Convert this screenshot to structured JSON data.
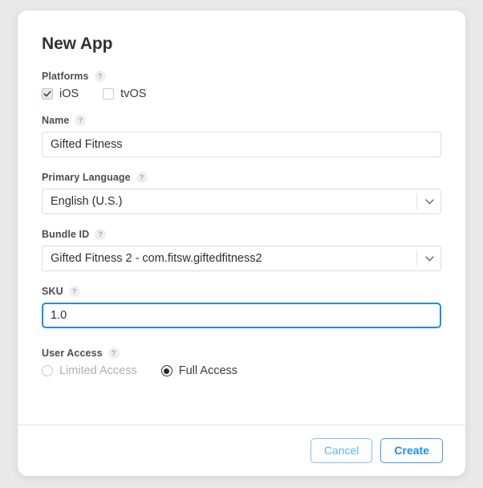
{
  "dialog": {
    "title": "New App",
    "help_glyph": "?"
  },
  "platforms": {
    "label": "Platforms",
    "options": [
      {
        "label": "iOS",
        "checked": true
      },
      {
        "label": "tvOS",
        "checked": false
      }
    ]
  },
  "name": {
    "label": "Name",
    "value": "Gifted Fitness",
    "placeholder": ""
  },
  "primary_language": {
    "label": "Primary Language",
    "value": "English (U.S.)"
  },
  "bundle_id": {
    "label": "Bundle ID",
    "value": "Gifted Fitness 2 - com.fitsw.giftedfitness2"
  },
  "sku": {
    "label": "SKU",
    "value": "1.0",
    "placeholder": "",
    "focused": true
  },
  "user_access": {
    "label": "User Access",
    "options": [
      {
        "label": "Limited Access",
        "selected": false,
        "disabled": true
      },
      {
        "label": "Full Access",
        "selected": true,
        "disabled": false
      }
    ]
  },
  "footer": {
    "cancel_label": "Cancel",
    "create_label": "Create"
  },
  "colors": {
    "accent_blue": "#1a8cff",
    "cancel_blue": "#5fb2fb",
    "backdrop": "#e9e9e9",
    "dialog_bg": "#ffffff",
    "border": "#dcdcdc",
    "label_text": "#4c4c4c",
    "value_text": "#2e2e2e",
    "disabled_text": "#b0b0b0"
  }
}
